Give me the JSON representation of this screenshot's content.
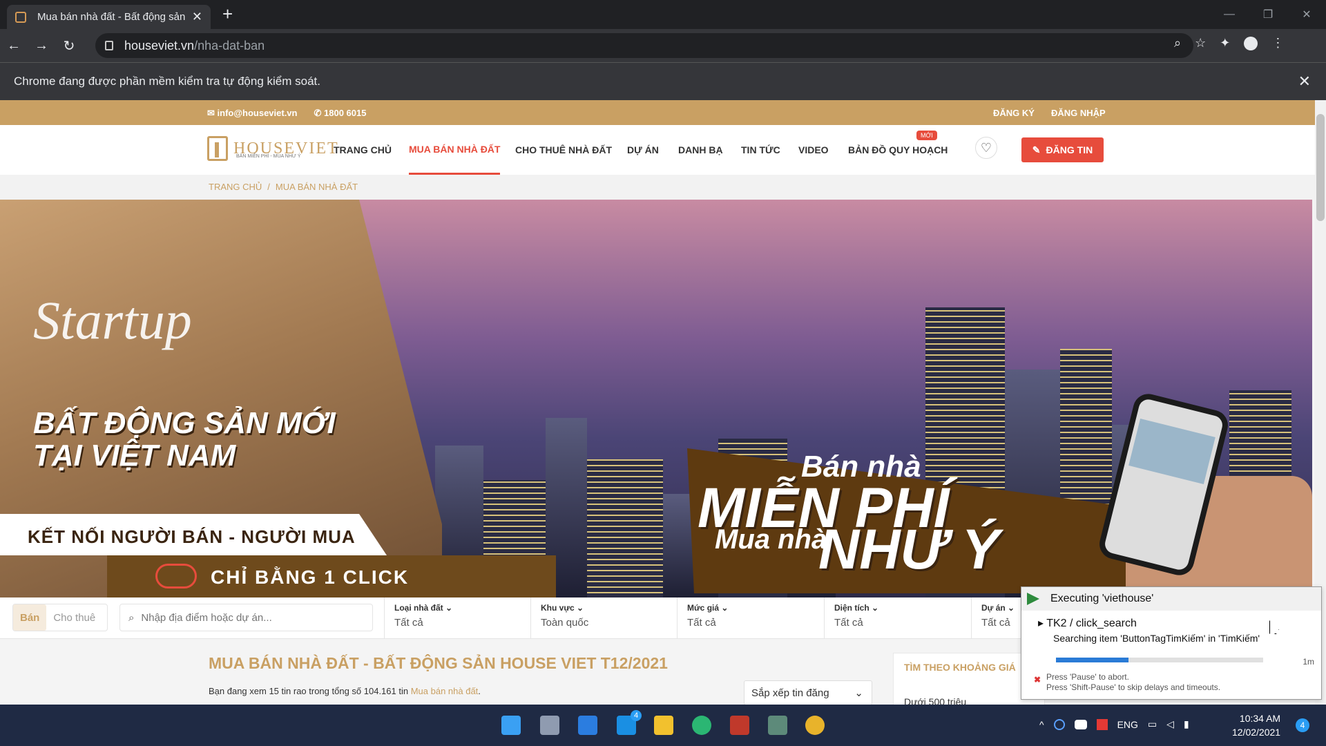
{
  "browser": {
    "tab_title": "Mua bán nhà đất - Bất động sản",
    "tab_close": "✕",
    "new_tab": "+",
    "url_host": "houseviet.vn",
    "url_path": "/nha-dat-ban",
    "back": "←",
    "forward": "→",
    "reload": "↻",
    "zoom_icon": "⌕",
    "star_icon": "☆",
    "ext_icon": "✦",
    "menu_icon": "⋮",
    "automation_notice": "Chrome đang được phần mềm kiểm tra tự động kiểm soát.",
    "notice_close": "✕",
    "win_minimize": "—",
    "win_restore": "❐",
    "win_close": "✕"
  },
  "site": {
    "email": "info@houseviet.vn",
    "phone": "1800 6015",
    "register": "ĐĂNG KÝ",
    "login": "ĐĂNG NHẬP",
    "logo_text": "HOUSEVIET",
    "logo_tagline": "BÁN MIỄN PHÍ - MUA NHƯ Ý",
    "nav": {
      "home": "TRANG CHỦ",
      "sale": "MUA BÁN NHÀ ĐẤT",
      "rent": "CHO THUÊ NHÀ ĐẤT",
      "projects": "DỰ ÁN",
      "directory": "DANH BẠ",
      "news": "TIN TỨC",
      "video": "VIDEO",
      "planning_map": "BẢN ĐỒ QUY HOẠCH",
      "new_badge": "MỚI"
    },
    "post_button": "ĐĂNG TIN",
    "heart_icon": "♡",
    "breadcrumb": {
      "home": "TRANG CHỦ",
      "sep": "/",
      "current": "MUA BÁN NHÀ ĐẤT"
    }
  },
  "banner": {
    "script_text": "Startup",
    "headline_1": "BẤT ĐỘNG SẢN MỚI",
    "headline_2": "TẠI VIỆT NAM",
    "connect": "KẾT NỐI NGƯỜI BÁN - NGƯỜI MUA",
    "one_click": "CHỈ BẰNG 1 CLICK",
    "promo_1": "Bán nhà",
    "promo_2": "MIỄN PHÍ",
    "promo_3": "Mua nhà",
    "promo_4": "NHƯ Ý"
  },
  "search": {
    "tab_sale": "Bán",
    "tab_rent": "Cho thuê",
    "placeholder": "Nhập địa điểm hoặc dự án...",
    "filters": [
      {
        "label": "Loại nhà đất",
        "value": "Tất cả"
      },
      {
        "label": "Khu vực",
        "value": "Toàn quốc"
      },
      {
        "label": "Mức giá",
        "value": "Tất cả"
      },
      {
        "label": "Diện tích",
        "value": "Tất cả"
      },
      {
        "label": "Dự án",
        "value": "Tất cả"
      }
    ]
  },
  "content": {
    "title": "MUA BÁN NHÀ ĐẤT - BẤT ĐỘNG SẢN HOUSE VIET T12/2021",
    "summary_prefix": "Bạn đang xem 15 tin rao trong tổng số 104.161 tin",
    "summary_link": "Mua bán nhà đất",
    "summary_suffix": ".",
    "sort_label": "Sắp xếp tin đăng",
    "price_box_title": "TÌM THEO KHOẢNG GIÁ",
    "price_box_item": "Dưới 500 triệu"
  },
  "automation_popup": {
    "title": "Executing 'viethouse'",
    "step": "TK2 / click_search",
    "detail": "Searching item 'ButtonTagTimKiếm' in 'TimKiếm'",
    "progress": 0.35,
    "elapsed": "1m",
    "note_1": "Press 'Pause' to abort.",
    "note_2": "Press 'Shift-Pause' to skip delays and timeouts.",
    "abort_icon": "✖"
  },
  "taskbar": {
    "tray_language": "ENG",
    "time": "10:34 AM",
    "date": "12/02/2021",
    "notifications": "4",
    "mail_badge": "4",
    "chevron": "^"
  },
  "colors": {
    "brand_gold": "#c9a063",
    "accent_red": "#e74c3c",
    "chrome_dark": "#202124"
  }
}
